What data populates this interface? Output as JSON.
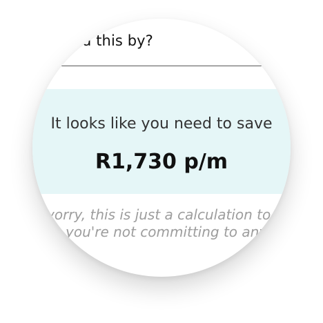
{
  "form": {
    "question_fragment": "d this by?"
  },
  "result": {
    "caption": "It looks like you need to save",
    "amount": "R1,730 p/m"
  },
  "disclaimer": {
    "line1": "vorry, this is just a calculation to he",
    "line2": "you're not committing to anyt"
  }
}
